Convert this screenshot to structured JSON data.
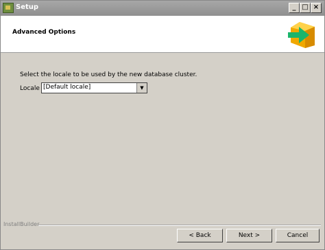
{
  "window": {
    "title": "Setup"
  },
  "header": {
    "title": "Advanced Options"
  },
  "content": {
    "instruction": "Select the locale to be used by the new database cluster.",
    "locale_label": "Locale"
  },
  "locale_select": {
    "value": "[Default locale]"
  },
  "footer": {
    "brand": "InstallBuilder"
  },
  "buttons": {
    "back": "< Back",
    "next": "Next >",
    "cancel": "Cancel"
  },
  "colors": {
    "window_bg": "#d4d0c8",
    "title_bar": "#a0a0a0",
    "logo_box": "#f0a800",
    "logo_arrow": "#1ab56b"
  }
}
